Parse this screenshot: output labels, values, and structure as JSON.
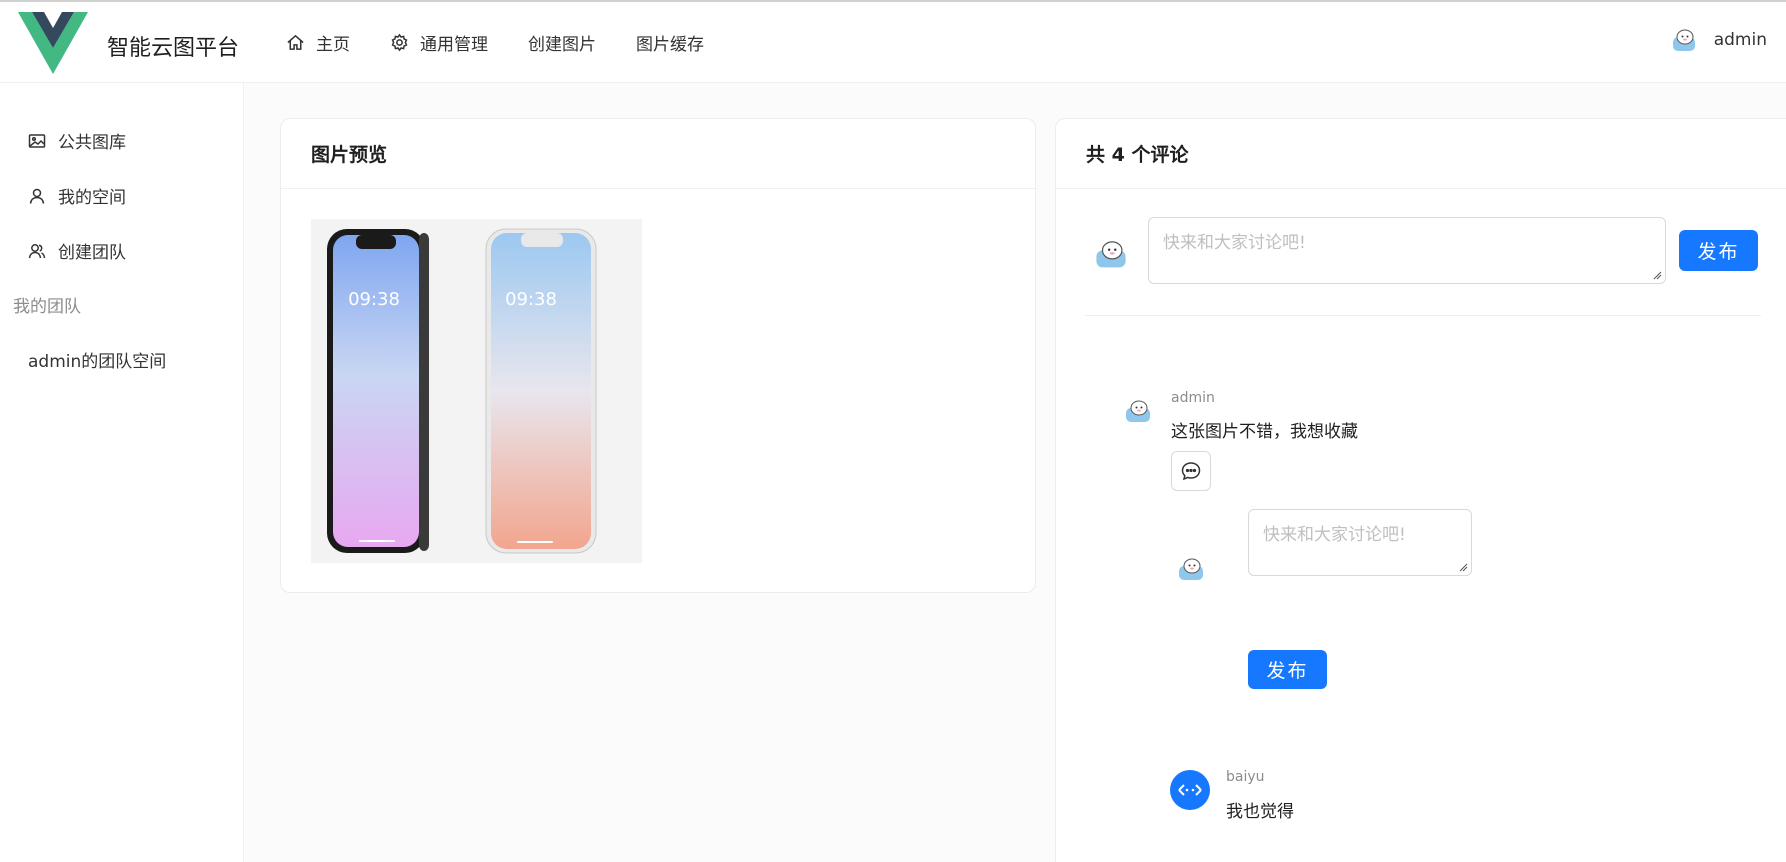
{
  "header": {
    "brand": "智能云图平台",
    "nav": [
      {
        "label": "主页",
        "icon": "home-icon"
      },
      {
        "label": "通用管理",
        "icon": "gear-icon"
      },
      {
        "label": "创建图片",
        "icon": ""
      },
      {
        "label": "图片缓存",
        "icon": ""
      }
    ],
    "user": {
      "name": "admin",
      "avatar_icon": "cartoon-avatar-icon"
    }
  },
  "sidebar": {
    "items": [
      {
        "label": "公共图库",
        "icon": "picture-icon"
      },
      {
        "label": "我的空间",
        "icon": "user-icon"
      },
      {
        "label": "创建团队",
        "icon": "team-icon"
      }
    ],
    "group_label": "我的团队",
    "team_items": [
      {
        "label": "admin的团队空间"
      }
    ]
  },
  "preview": {
    "title": "图片预览",
    "image_alt": "two smartphones",
    "phone_time_1": "09:38",
    "phone_time_2": "09:38"
  },
  "comments": {
    "title": "共 4 个评论",
    "input_placeholder": "快来和大家讨论吧!",
    "publish_label": "发布",
    "list": [
      {
        "user": "admin",
        "text": "这张图片不错，我想收藏"
      },
      {
        "user": "baiyu",
        "text": "我也觉得"
      }
    ],
    "reply_input_placeholder": "快来和大家讨论吧!",
    "reply_publish_label": "发布"
  },
  "colors": {
    "primary": "#1677ff",
    "logo_outer": "#42b883",
    "logo_inner": "#35495e"
  }
}
